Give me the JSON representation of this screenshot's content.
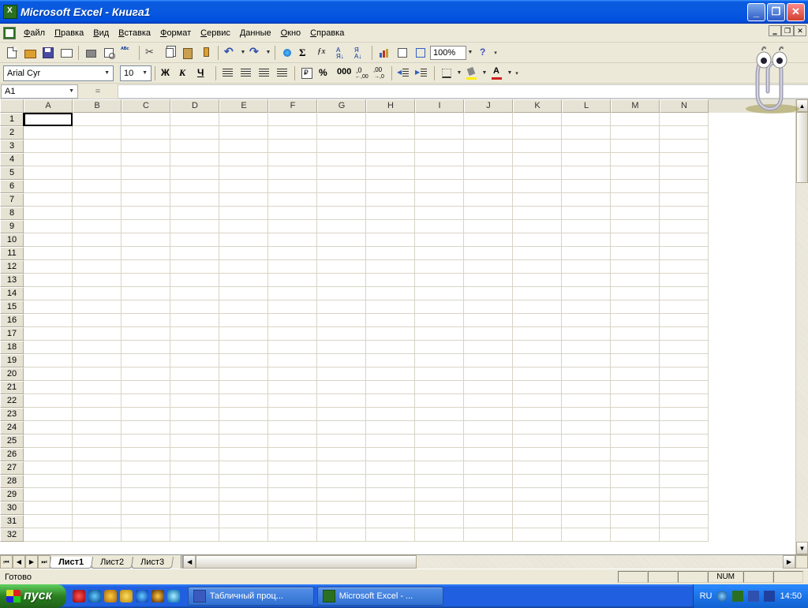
{
  "title": "Microsoft Excel - Книга1",
  "menus": [
    "Файл",
    "Правка",
    "Вид",
    "Вставка",
    "Формат",
    "Сервис",
    "Данные",
    "Окно",
    "Справка"
  ],
  "zoom": "100%",
  "font": {
    "name": "Arial Cyr",
    "size": "10"
  },
  "format_labels": {
    "bold": "Ж",
    "italic": "К",
    "underline": "Ч",
    "sum": "Σ",
    "fx": "ƒx",
    "percent": "%",
    "comma": "000"
  },
  "namebox": "A1",
  "fx_label": "=",
  "columns": [
    "A",
    "B",
    "C",
    "D",
    "E",
    "F",
    "G",
    "H",
    "I",
    "J",
    "K",
    "L",
    "M",
    "N"
  ],
  "row_count": 32,
  "active_cell": {
    "row": 1,
    "col": "A"
  },
  "sheets": [
    "Лист1",
    "Лист2",
    "Лист3"
  ],
  "active_sheet": 0,
  "status": {
    "ready": "Готово",
    "num": "NUM"
  },
  "taskbar": {
    "start": "пуск",
    "buttons": [
      {
        "label": "Табличный проц...",
        "kind": "word"
      },
      {
        "label": "Microsoft Excel - ...",
        "kind": "excel"
      }
    ],
    "lang": "RU",
    "clock": "14:50"
  }
}
